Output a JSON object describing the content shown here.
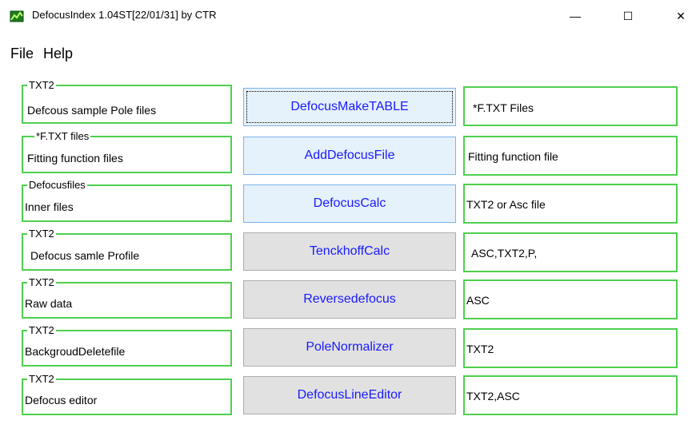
{
  "window": {
    "title": "DefocusIndex 1.04ST[22/01/31] by CTR",
    "icon": "app-icon",
    "minimize": "—",
    "maximize": "☐",
    "close": "✕"
  },
  "menu": {
    "file": "File",
    "help": "Help"
  },
  "rows": [
    {
      "legend": "TXT2",
      "text": "Defcous sample Pole files",
      "button": "DefocusMakeTABLE",
      "result": "*F.TXT Files"
    },
    {
      "legend": "*F.TXT files",
      "text": "Fitting function files",
      "button": "AddDefocusFile",
      "result": "Fitting function file"
    },
    {
      "legend": "Defocusfiles",
      "text": "Inner files",
      "button": "DefocusCalc",
      "result": "TXT2 or Asc file"
    },
    {
      "legend": "TXT2",
      "text": "Defocus samle Profile",
      "button": "TenckhoffCalc",
      "result": "ASC,TXT2,P,"
    },
    {
      "legend": "TXT2",
      "text": "Raw data",
      "button": "Reversedefocus",
      "result": "ASC"
    },
    {
      "legend": "TXT2",
      "text": "BackgroudDeletefile",
      "button": "PoleNormalizer",
      "result": "TXT2"
    },
    {
      "legend": "TXT2",
      "text": "Defocus editor",
      "button": "DefocusLineEditor",
      "result": "TXT2,ASC"
    }
  ],
  "colors": {
    "group_border": "#4fcf4f",
    "button_text": "#1a1aff",
    "button_blue_bg": "#e5f1fb",
    "button_gray_bg": "#e1e1e1"
  }
}
